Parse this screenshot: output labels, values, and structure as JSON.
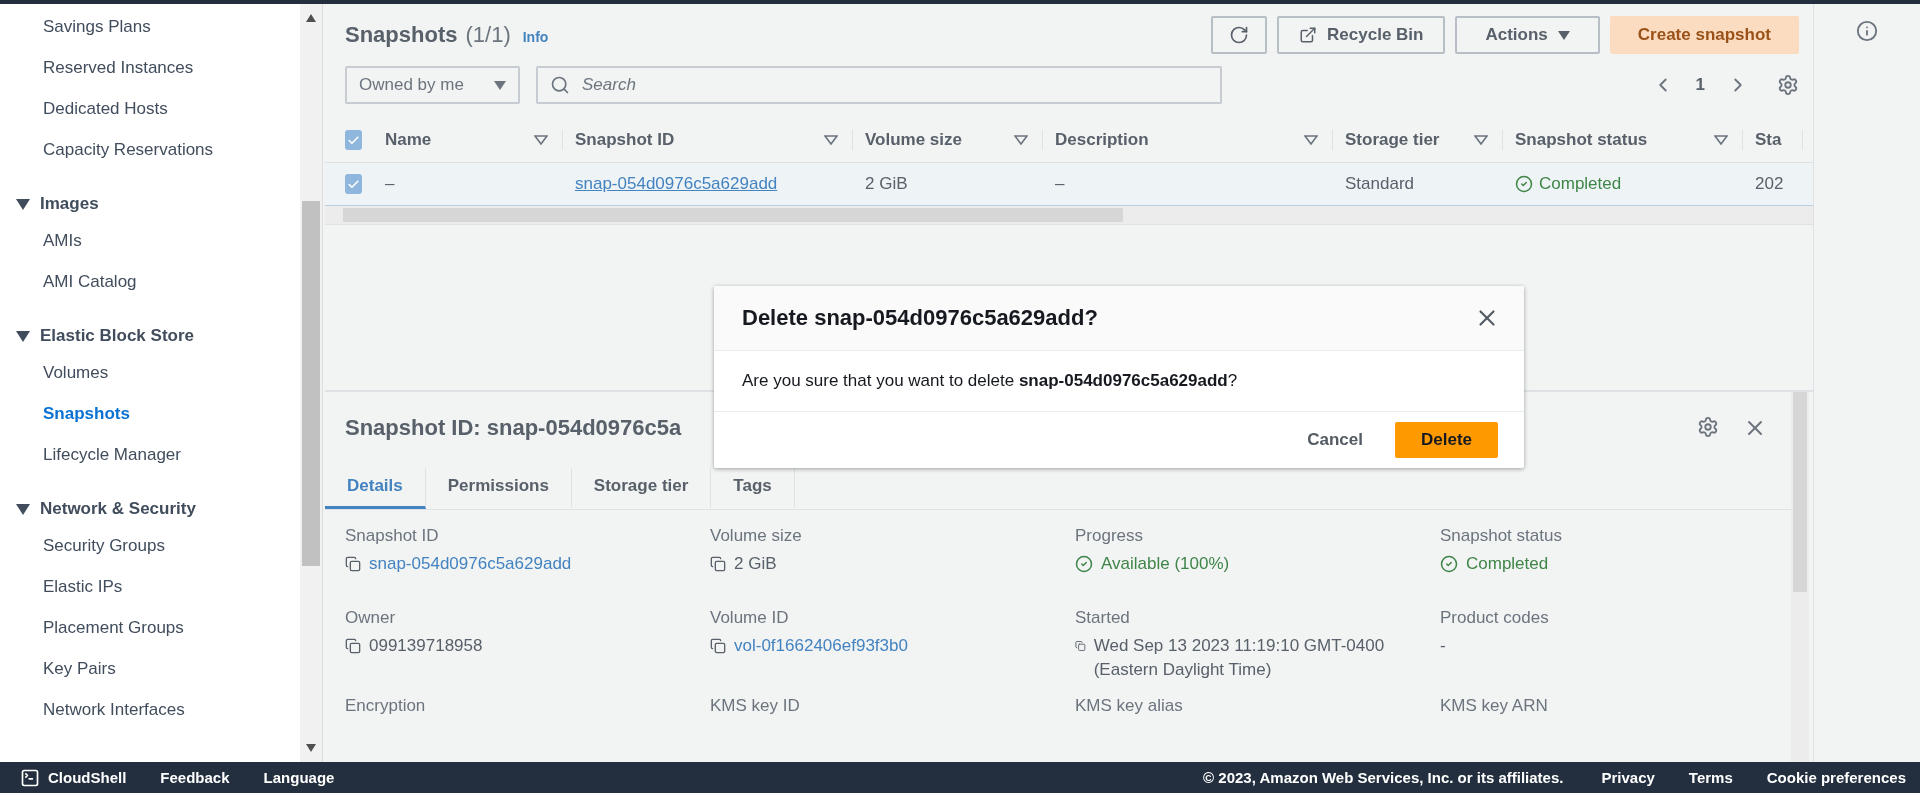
{
  "sidebar": {
    "items": [
      {
        "label": "Savings Plans",
        "selected": false
      },
      {
        "label": "Reserved Instances",
        "selected": false
      },
      {
        "label": "Dedicated Hosts",
        "selected": false
      },
      {
        "label": "Capacity Reservations",
        "selected": false
      }
    ],
    "sections": [
      {
        "title": "Images",
        "expanded": true,
        "items": [
          {
            "label": "AMIs",
            "selected": false
          },
          {
            "label": "AMI Catalog",
            "selected": false
          }
        ]
      },
      {
        "title": "Elastic Block Store",
        "expanded": true,
        "items": [
          {
            "label": "Volumes",
            "selected": false
          },
          {
            "label": "Snapshots",
            "selected": true
          },
          {
            "label": "Lifecycle Manager",
            "selected": false
          }
        ]
      },
      {
        "title": "Network & Security",
        "expanded": true,
        "items": [
          {
            "label": "Security Groups",
            "selected": false
          },
          {
            "label": "Elastic IPs",
            "selected": false
          },
          {
            "label": "Placement Groups",
            "selected": false
          },
          {
            "label": "Key Pairs",
            "selected": false
          },
          {
            "label": "Network Interfaces",
            "selected": false
          }
        ]
      }
    ]
  },
  "snapshots": {
    "title": "Snapshots",
    "count": "(1/1)",
    "info": "Info",
    "buttons": {
      "recycle_bin": "Recycle Bin",
      "actions": "Actions",
      "create": "Create snapshot"
    },
    "filter": "Owned by me",
    "search": {
      "placeholder": "Search"
    },
    "page": "1"
  },
  "table": {
    "all_checked": true,
    "columns": [
      "Name",
      "Snapshot ID",
      "Volume size",
      "Description",
      "Storage tier",
      "Snapshot status",
      "Sta"
    ],
    "rows": [
      {
        "checked": true,
        "selected": true,
        "cells": [
          "–",
          "snap-054d0976c5a629add",
          "2 GiB",
          "–",
          "Standard",
          "Completed",
          "202"
        ]
      }
    ]
  },
  "details": {
    "title": "Snapshot ID: snap-054d0976c5a",
    "tabs": [
      {
        "label": "Details",
        "selected": true
      },
      {
        "label": "Permissions",
        "selected": false
      },
      {
        "label": "Storage tier",
        "selected": false
      },
      {
        "label": "Tags",
        "selected": false
      }
    ],
    "fields": [
      {
        "label": "Snapshot ID",
        "kind": "link",
        "value": "snap-054d0976c5a629add"
      },
      {
        "label": "Volume size",
        "kind": "copy",
        "value": "2 GiB"
      },
      {
        "label": "Progress",
        "kind": "status",
        "value": "Available (100%)"
      },
      {
        "label": "Snapshot status",
        "kind": "status",
        "value": "Completed"
      },
      {
        "label": "Owner",
        "kind": "copy",
        "value": "099139718958"
      },
      {
        "label": "Volume ID",
        "kind": "link",
        "value": "vol-0f1662406ef93f3b0"
      },
      {
        "label": "Started",
        "kind": "copy",
        "value": "Wed Sep 13 2023 11:19:10 GMT-0400 (Eastern Daylight Time)"
      },
      {
        "label": "Product codes",
        "kind": "plain",
        "value": "-"
      },
      {
        "label": "Encryption",
        "kind": "none"
      },
      {
        "label": "KMS key ID",
        "kind": "none"
      },
      {
        "label": "KMS key alias",
        "kind": "none"
      },
      {
        "label": "KMS key ARN",
        "kind": "none"
      }
    ]
  },
  "modal": {
    "title": "Delete snap-054d0976c5a629add?",
    "body": "Are you sure that you want to delete **snap-054d0976c5a629add**?",
    "cancel": "Cancel",
    "confirm": "Delete"
  },
  "footer": {
    "cloudshell": "CloudShell",
    "feedback": "Feedback",
    "language": "Language",
    "copyright": "© 2023, Amazon Web Services, Inc. or its affiliates.",
    "links": [
      "Privacy",
      "Terms",
      "Cookie preferences"
    ]
  }
}
